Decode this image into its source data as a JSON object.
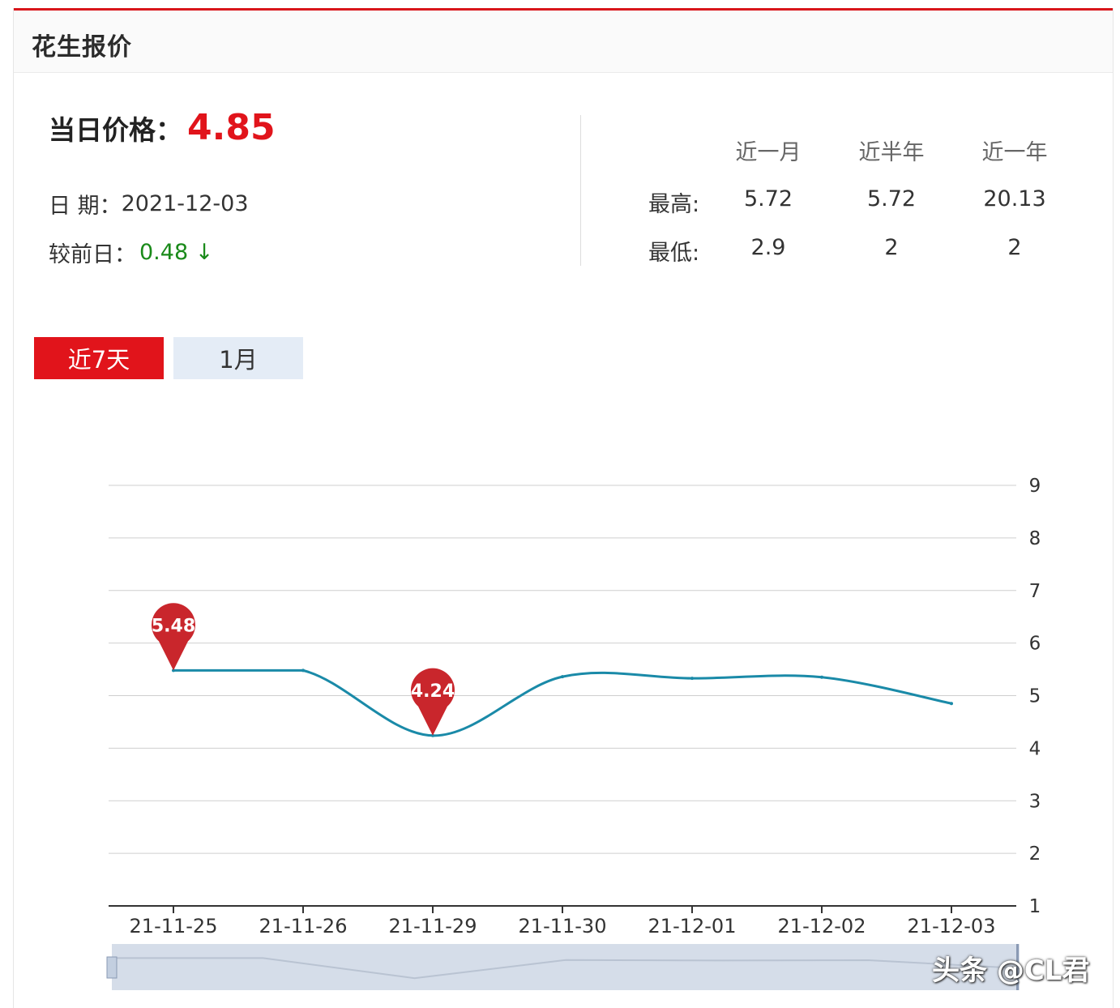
{
  "header": {
    "title": "花生报价"
  },
  "summary": {
    "price_label": "当日价格：",
    "price_value": "4.85",
    "date_label": "日 期：",
    "date_value": "2021-12-03",
    "change_label": "较前日：",
    "change_value": "0.48 ↓"
  },
  "stats": {
    "columns": [
      "近一月",
      "近半年",
      "近一年"
    ],
    "rows": [
      {
        "label": "最高:",
        "values": [
          "5.72",
          "5.72",
          "20.13"
        ]
      },
      {
        "label": "最低:",
        "values": [
          "2.9",
          "2",
          "2"
        ]
      }
    ]
  },
  "tabs": [
    {
      "label": "近7天",
      "active": true
    },
    {
      "label": "1月",
      "active": false
    }
  ],
  "colors": {
    "accent": "#e1141b",
    "line": "#1a8aa8",
    "change_down": "#1a8a1a",
    "tab_inactive_bg": "#e4ecf6"
  },
  "chart_data": {
    "type": "line",
    "categories": [
      "21-11-25",
      "21-11-26",
      "21-11-29",
      "21-11-30",
      "21-12-01",
      "21-12-02",
      "21-12-03"
    ],
    "series": [
      {
        "values": [
          5.48,
          5.48,
          4.24,
          5.36,
          5.33,
          5.35,
          4.85
        ]
      }
    ],
    "annotations": [
      {
        "category": "21-11-25",
        "value": 5.48,
        "label": "5.48"
      },
      {
        "category": "21-11-29",
        "value": 4.24,
        "label": "4.24"
      }
    ],
    "yticks": [
      "1",
      "2",
      "3",
      "4",
      "5",
      "6",
      "7",
      "8",
      "9"
    ],
    "ylim": [
      1,
      9
    ],
    "y_axis_side": "right",
    "grid": true,
    "zoom_slider": true
  },
  "watermark": "头条 @CL君"
}
